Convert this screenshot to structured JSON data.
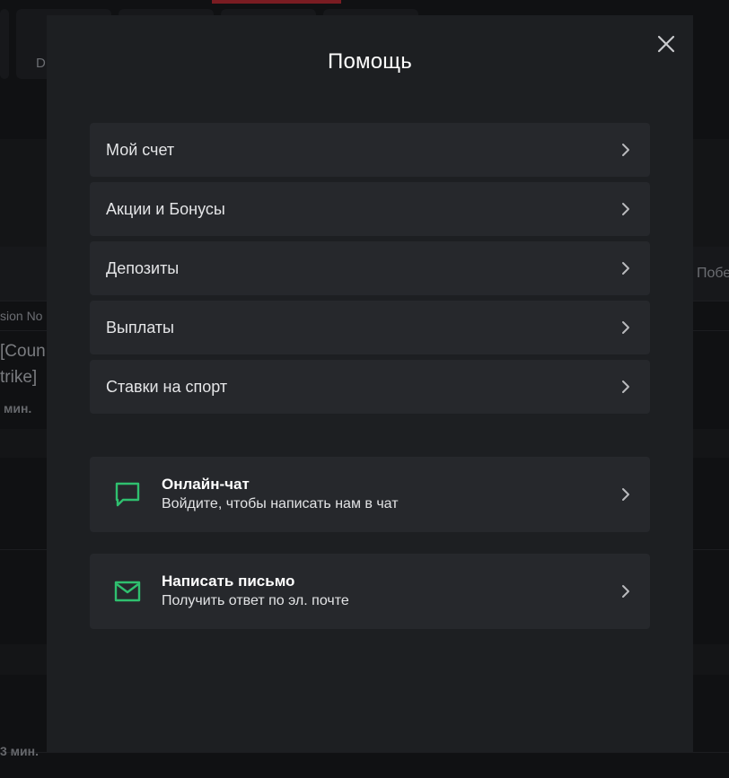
{
  "background": {
    "tab_fragment": "D",
    "column_fragment": "Побе",
    "header_fragment": "sion No",
    "title_fragment_1": "[Coun",
    "title_fragment_2": "trike]",
    "time_fragment_1": "мин.",
    "time_fragment_2": "3 мин."
  },
  "modal": {
    "title": "Помощь",
    "close_icon": "close-icon",
    "menu_items": [
      {
        "label": "Мой счет",
        "icon": "chevron-right-icon"
      },
      {
        "label": "Акции и Бонусы",
        "icon": "chevron-right-icon"
      },
      {
        "label": "Депозиты",
        "icon": "chevron-right-icon"
      },
      {
        "label": "Выплаты",
        "icon": "chevron-right-icon"
      },
      {
        "label": "Ставки на спорт",
        "icon": "chevron-right-icon"
      }
    ],
    "contacts": [
      {
        "title": "Онлайн-чат",
        "subtitle": "Войдите, чтобы написать нам в чат",
        "icon": "chat-bubble-icon"
      },
      {
        "title": "Написать письмо",
        "subtitle": "Получить ответ по эл. почте",
        "icon": "envelope-icon"
      }
    ]
  },
  "colors": {
    "accent_green": "#2fc06f",
    "modal_bg": "#1d1f22",
    "item_bg": "#26282c",
    "active_tab_red": "#7a1c22"
  }
}
